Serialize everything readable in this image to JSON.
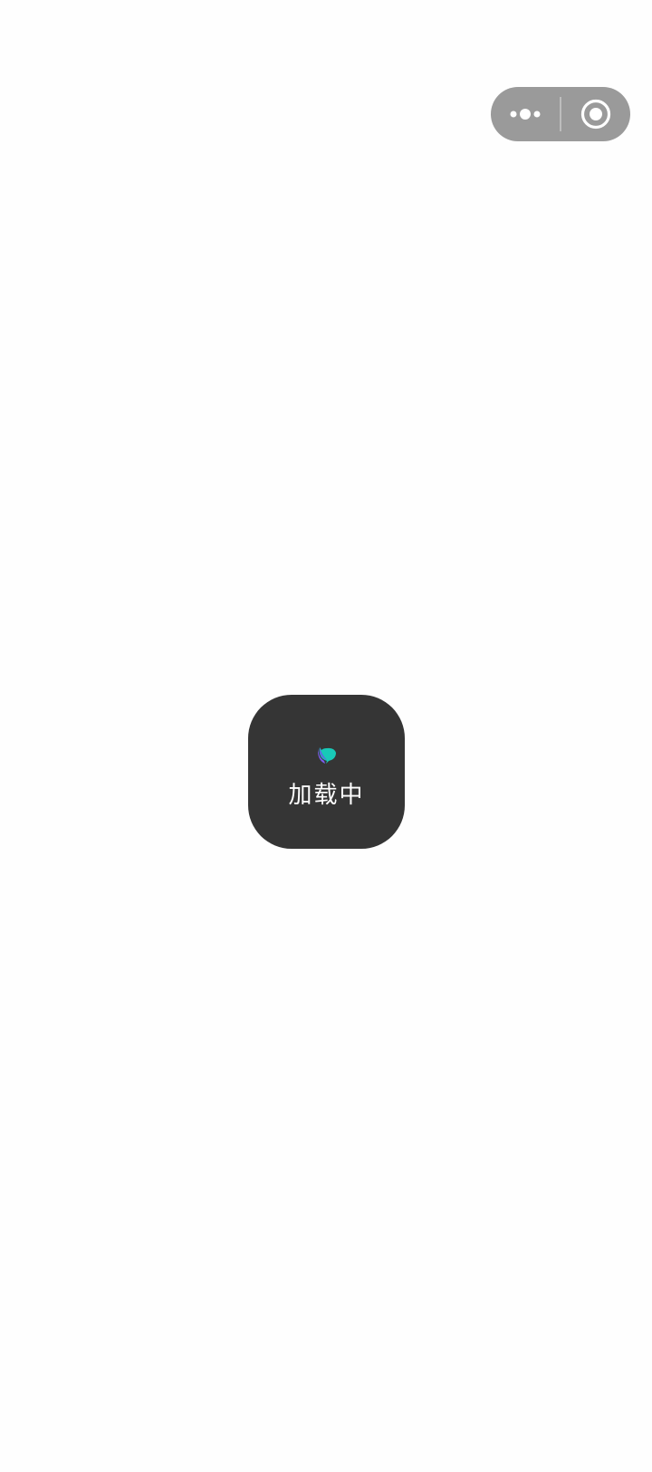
{
  "capsule": {
    "more_icon": "more-dots-icon",
    "close_icon": "close-circle-icon",
    "background": "#9a9a9a"
  },
  "loading": {
    "text": "加载中",
    "icon": "loading-spinner-icon",
    "background": "#353535",
    "accent_colors": [
      "#18c9b7",
      "#7b5cf0"
    ]
  }
}
